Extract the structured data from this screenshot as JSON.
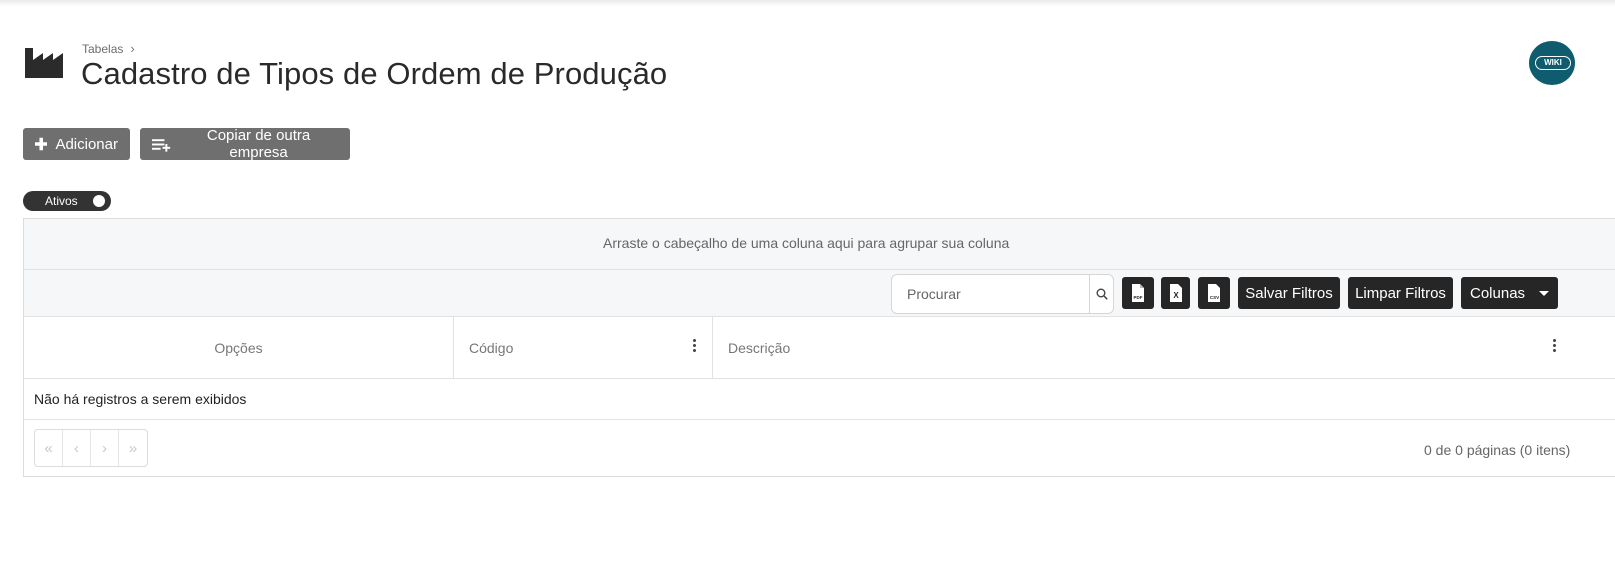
{
  "header": {
    "breadcrumb": {
      "parent": "Tabelas",
      "separator": "›"
    },
    "title": "Cadastro de Tipos de Ordem de Produção",
    "page_icon": "factory-icon",
    "wiki_label": "WIKI"
  },
  "actions": {
    "add_label": "Adicionar",
    "add_icon": "plus-icon",
    "copy_label": "Copiar de outra empresa",
    "copy_icon": "playlist-add-icon"
  },
  "filter_toggle": {
    "label": "Ativos",
    "on": true
  },
  "grid": {
    "group_panel_text": "Arraste o cabeçalho de uma coluna aqui para agrupar sua coluna",
    "search": {
      "placeholder": "Procurar",
      "value": ""
    },
    "toolbar": {
      "export_pdf_icon": "pdf-file-icon",
      "export_excel_icon": "excel-file-icon",
      "export_csv_icon": "csv-file-icon",
      "save_filters": "Salvar Filtros",
      "clear_filters": "Limpar Filtros",
      "columns": "Colunas"
    },
    "columns": [
      "Opções",
      "Código",
      "Descrição"
    ],
    "empty_message": "Não há registros a serem exibidos",
    "pager": {
      "first": "«",
      "prev": "‹",
      "next": "›",
      "last": "»",
      "info": "0 de 0 páginas (0 itens)"
    }
  },
  "colors": {
    "primary_gray": "#6f6f6f",
    "dark_button": "#262626",
    "wiki_teal": "#0f5c6e",
    "panel_bg": "#f6f7f8"
  }
}
